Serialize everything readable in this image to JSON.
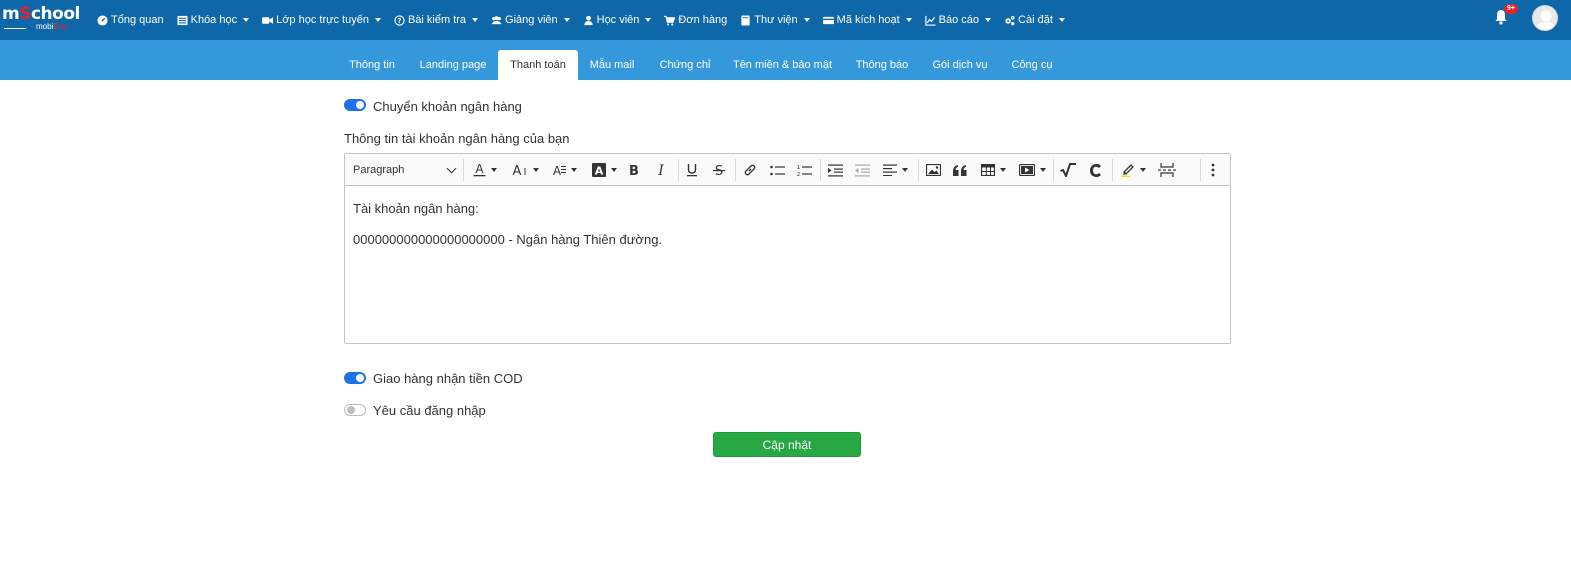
{
  "brand": {
    "name_prefix": "m",
    "name_accent": "S",
    "name_suffix": "chool",
    "sub_prefix": "mobi",
    "sub_accent": "Edu"
  },
  "nav": {
    "items": [
      {
        "label": "Tổng quan",
        "icon": "dashboard-icon",
        "dropdown": false
      },
      {
        "label": "Khóa học",
        "icon": "list-icon",
        "dropdown": true
      },
      {
        "label": "Lớp học trực tuyến",
        "icon": "video-camera-icon",
        "dropdown": true
      },
      {
        "label": "Bài kiểm tra",
        "icon": "question-circle-icon",
        "dropdown": true
      },
      {
        "label": "Giảng viên",
        "icon": "users-icon",
        "dropdown": true
      },
      {
        "label": "Học viên",
        "icon": "user-icon",
        "dropdown": true
      },
      {
        "label": "Đơn hàng",
        "icon": "cart-icon",
        "dropdown": false
      },
      {
        "label": "Thư viện",
        "icon": "book-icon",
        "dropdown": true
      },
      {
        "label": "Mã kích hoạt",
        "icon": "credit-card-icon",
        "dropdown": true
      },
      {
        "label": "Báo cáo",
        "icon": "line-chart-icon",
        "dropdown": true
      },
      {
        "label": "Cài đặt",
        "icon": "cogs-icon",
        "dropdown": true
      }
    ],
    "notification_badge": "9+"
  },
  "tabs": [
    {
      "label": "Thông tin",
      "active": false
    },
    {
      "label": "Landing page",
      "active": false
    },
    {
      "label": "Thanh toán",
      "active": true
    },
    {
      "label": "Mẫu mail",
      "active": false
    },
    {
      "label": "Chứng chỉ",
      "active": false
    },
    {
      "label": "Tên miền & bảo mật",
      "active": false
    },
    {
      "label": "Thông báo",
      "active": false
    },
    {
      "label": "Gói dịch vụ",
      "active": false
    },
    {
      "label": "Công cụ",
      "active": false
    }
  ],
  "payment": {
    "bank_transfer": {
      "label": "Chuyển khoản ngân hàng",
      "enabled": true
    },
    "bank_info_label": "Thông tin tài khoản ngân hàng của bạn",
    "editor": {
      "paragraph_select": "Paragraph",
      "lines": [
        "Tài khoản ngân hàng:",
        "000000000000000000000 - Ngân hàng Thiên đường."
      ]
    },
    "cod": {
      "label": "Giao hàng nhận tiền COD",
      "enabled": true
    },
    "require_login": {
      "label": "Yêu cầu đăng nhập",
      "enabled": false
    },
    "submit_label": "Cập nhật"
  },
  "colors": {
    "topnav": "#0e67a8",
    "tabbar": "#3498db",
    "switch_on": "#1a73e8",
    "submit": "#28a745",
    "badge": "#e4242b"
  }
}
